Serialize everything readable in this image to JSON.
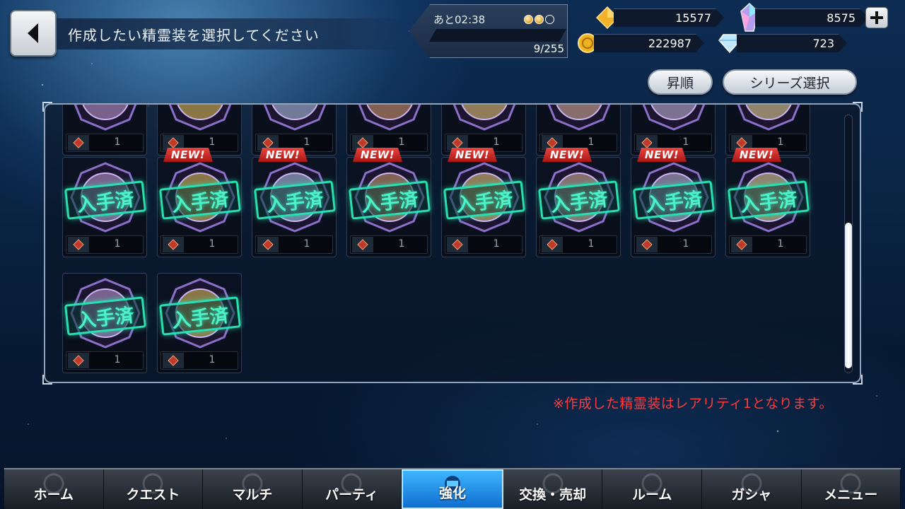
{
  "header": {
    "title": "作成したい精霊装を選択してください"
  },
  "status": {
    "timer": "あと02:38",
    "stamina": "9/255",
    "orbs": [
      "full",
      "full",
      "empty"
    ]
  },
  "currency": {
    "gold_crystal": "15577",
    "rainbow_crystal": "8575",
    "coins": "222987",
    "diamonds": "723"
  },
  "sort": {
    "order_label": "昇順",
    "series_label": "シリーズ選択"
  },
  "grid": {
    "stamp_text": "入手済",
    "new_label": "NEW!",
    "rows": [
      {
        "cards": [
          {
            "qty": "1"
          },
          {
            "qty": "1"
          },
          {
            "qty": "1"
          },
          {
            "qty": "1"
          },
          {
            "qty": "1"
          },
          {
            "qty": "1"
          },
          {
            "qty": "1"
          },
          {
            "qty": "1"
          }
        ]
      },
      {
        "cards": [
          {
            "qty": "1",
            "new": false
          },
          {
            "qty": "1",
            "new": true
          },
          {
            "qty": "1",
            "new": true
          },
          {
            "qty": "1",
            "new": true
          },
          {
            "qty": "1",
            "new": true
          },
          {
            "qty": "1",
            "new": true
          },
          {
            "qty": "1",
            "new": true
          },
          {
            "qty": "1",
            "new": true
          }
        ]
      },
      {
        "cards": [
          {
            "qty": "1",
            "new": false
          },
          {
            "qty": "1",
            "new": false
          }
        ]
      }
    ]
  },
  "note": "※作成した精霊装はレアリティ1となります。",
  "nav": {
    "items": [
      "ホーム",
      "クエスト",
      "マルチ",
      "パーティ",
      "強化",
      "交換・売却",
      "ルーム",
      "ガシャ",
      "メニュー"
    ],
    "active": "強化"
  },
  "colors": {
    "stamp": "#27e0b4",
    "new_badge": "#d8302c",
    "note": "#ff3b3b",
    "nav_active": "#1f8ee8"
  }
}
